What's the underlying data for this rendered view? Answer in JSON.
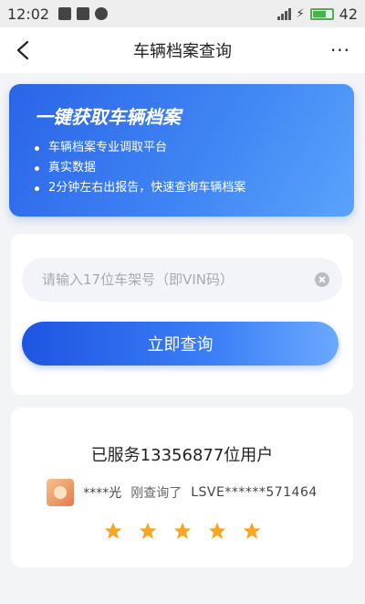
{
  "status_bar": {
    "time": "12:02",
    "battery_percent": "42"
  },
  "nav": {
    "title": "车辆档案查询",
    "more_label": "···"
  },
  "banner": {
    "title": "一键获取车辆档案",
    "features": [
      "车辆档案专业调取平台",
      "真实数据",
      "2分钟左右出报告，快速查询车辆档案"
    ]
  },
  "query": {
    "vin_placeholder": "请输入17位车架号（即VIN码）",
    "vin_value": "",
    "submit_label": "立即查询"
  },
  "served": {
    "title": "已服务13356877位用户",
    "recent_user": "****光",
    "recent_action": "刚查询了",
    "recent_vin": "LSVE******571464",
    "rating": 5,
    "star_color": "#f5a623"
  },
  "colors": {
    "accent": "#2a64e8",
    "button_gradient_start": "#1e55e3",
    "button_gradient_end": "#6aa9ff"
  }
}
